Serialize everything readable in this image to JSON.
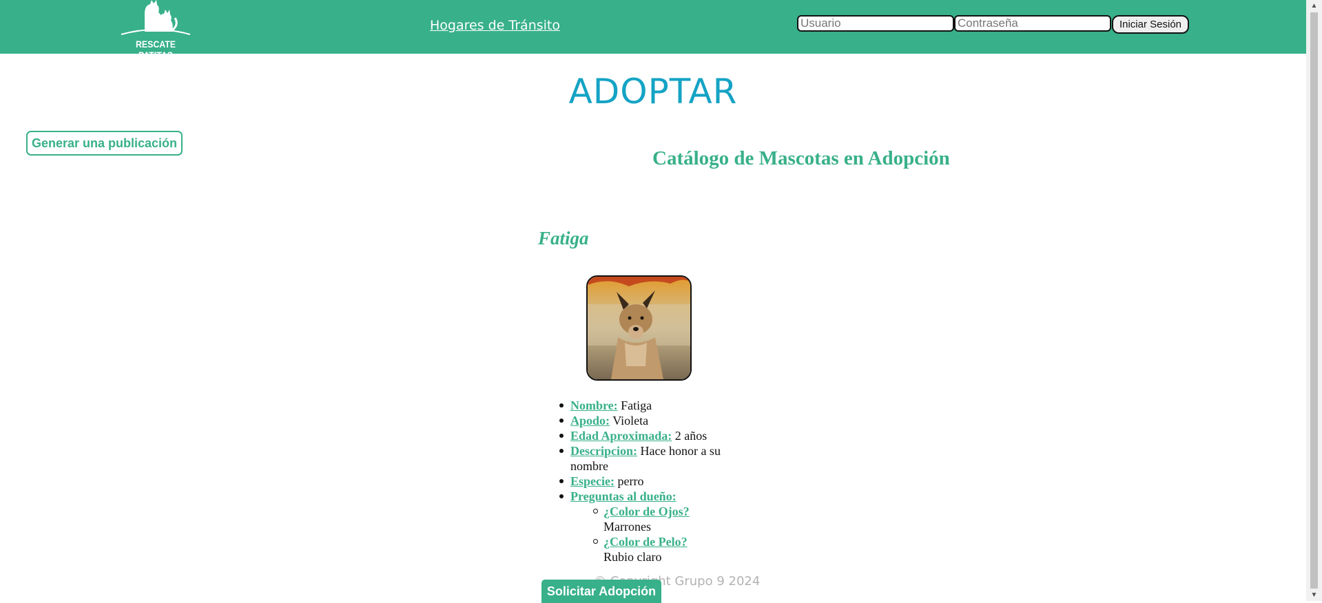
{
  "header": {
    "logo_text": "RESCATE PATITAS",
    "nav_link": "Hogares de Tránsito",
    "username_placeholder": "Usuario",
    "password_placeholder": "Contraseña",
    "login_label": "Iniciar Sesión"
  },
  "main": {
    "title": "ADOPTAR",
    "generate_button": "Generar una publicación",
    "catalog_title": "Catálogo de Mascotas en Adopción",
    "pet": {
      "name": "Fatiga",
      "details": {
        "nombre_label": "Nombre:",
        "nombre_value": "Fatiga",
        "apodo_label": "Apodo:",
        "apodo_value": "Violeta",
        "edad_label": "Edad Aproximada:",
        "edad_value": "2 años",
        "descripcion_label": "Descripcion:",
        "descripcion_value": "Hace honor a su nombre",
        "especie_label": "Especie:",
        "especie_value": "perro",
        "preguntas_label": "Preguntas al dueño:",
        "ojos_label": "¿Color de Ojos?",
        "ojos_value": "Marrones",
        "pelo_label": "¿Color de Pelo?",
        "pelo_value": "Rubio claro"
      },
      "adopt_button": "Solicitar Adopción"
    }
  },
  "footer": {
    "text": "© Copyright Grupo 9 2024"
  },
  "colors": {
    "header": "#38b08a",
    "title": "#14a3c4",
    "accent": "#38b08a",
    "footer_text": "#b3b3b3"
  }
}
